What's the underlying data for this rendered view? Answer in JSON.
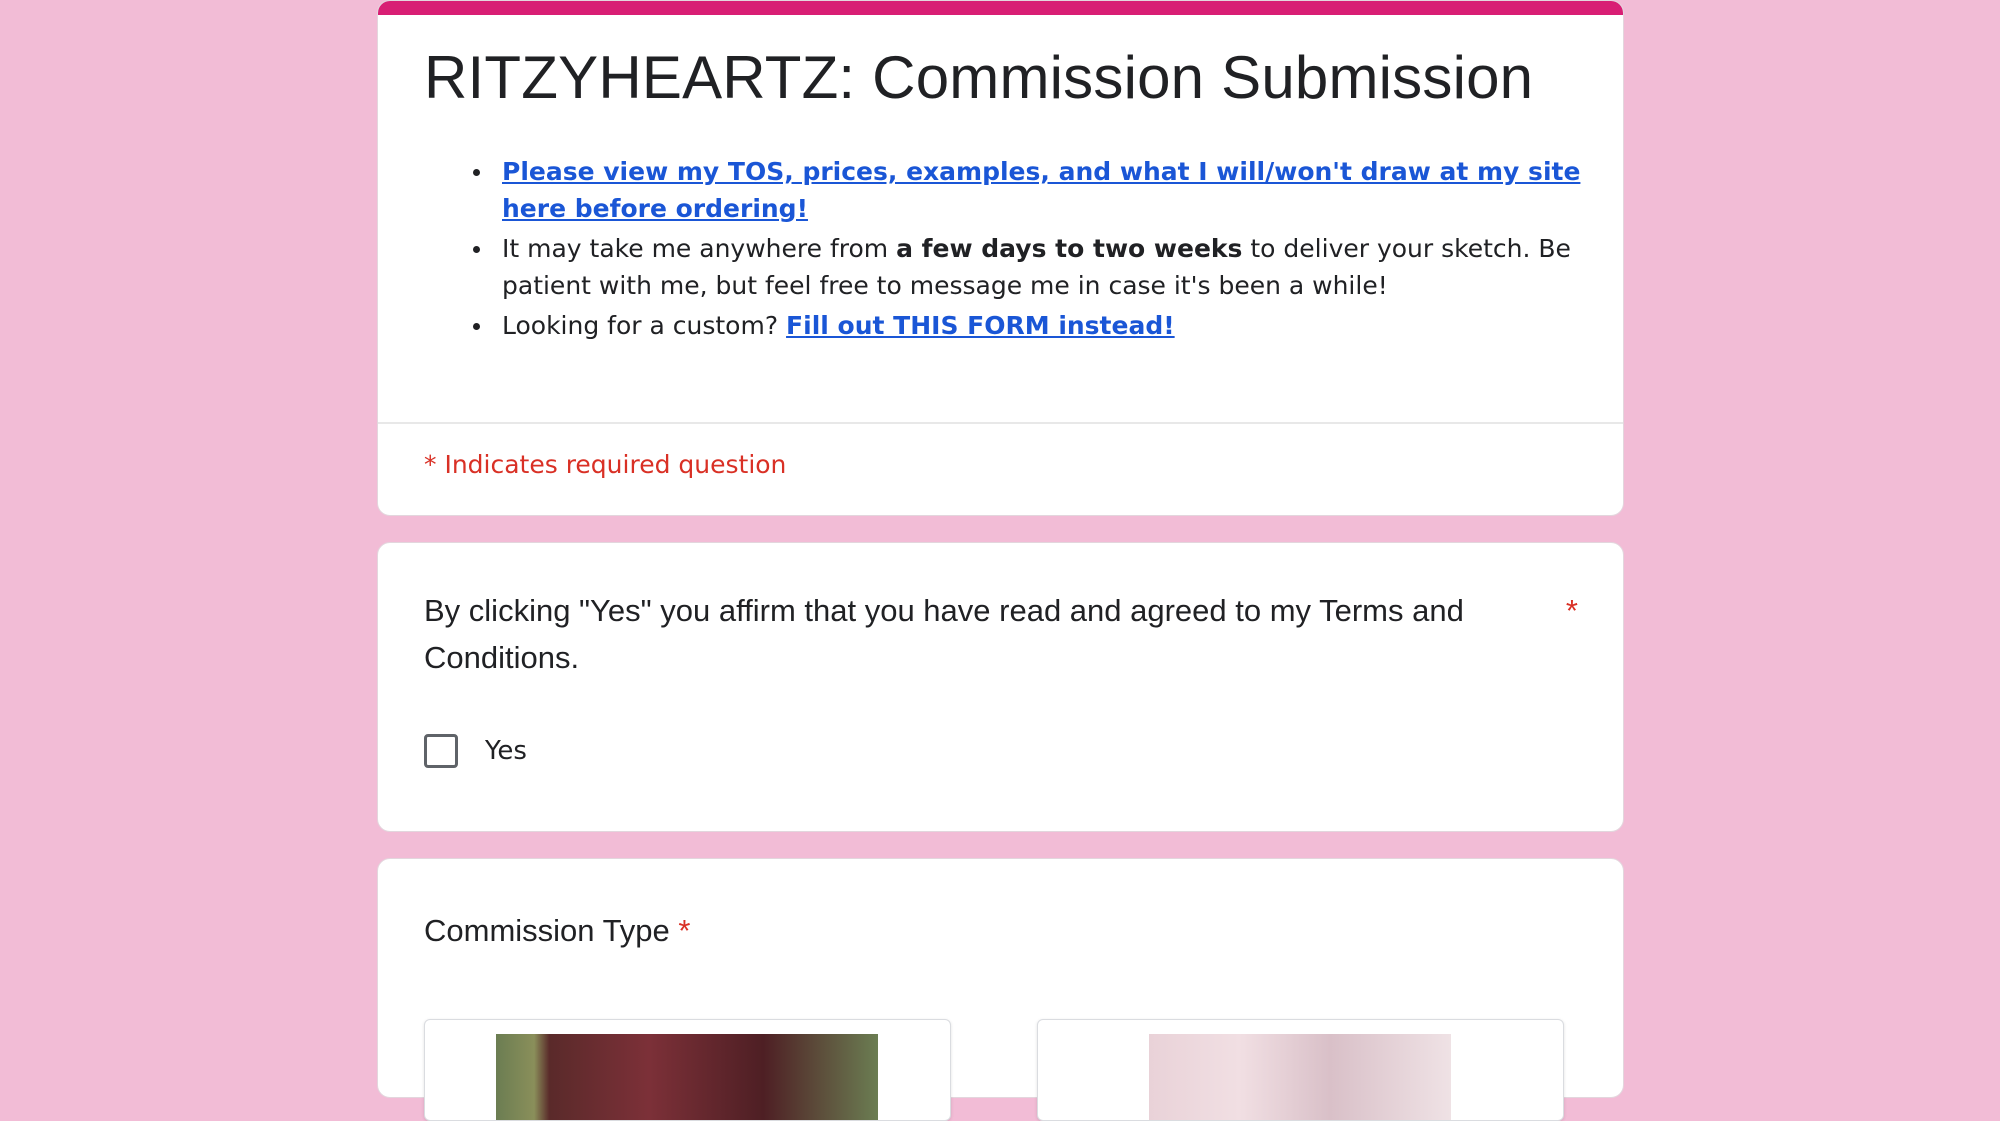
{
  "colors": {
    "page_background": "#f2bcd6",
    "accent": "#d81e74",
    "link": "#1a56d6",
    "required": "#d93025"
  },
  "header": {
    "title": "RITZYHEARTZ: Commission Submission",
    "bullets": {
      "b1_link": "Please view my TOS, prices, examples, and what I will/won't draw at my site here before ordering!",
      "b2_pre": "It may take me anywhere from ",
      "b2_bold": "a few days to two weeks",
      "b2_post": " to deliver your sketch. Be patient with me, but feel free to message me in case it's been a while!",
      "b3_pre": "Looking for a custom? ",
      "b3_link": "Fill out THIS FORM instead!"
    },
    "required_note": "* Indicates required question"
  },
  "question_terms": {
    "title": "By clicking \"Yes\" you affirm that you have read and agreed to my Terms and Conditions.",
    "required_mark": "*",
    "options": [
      {
        "label": "Yes",
        "checked": false
      }
    ]
  },
  "question_type": {
    "title": "Commission Type",
    "required_mark": "*"
  }
}
